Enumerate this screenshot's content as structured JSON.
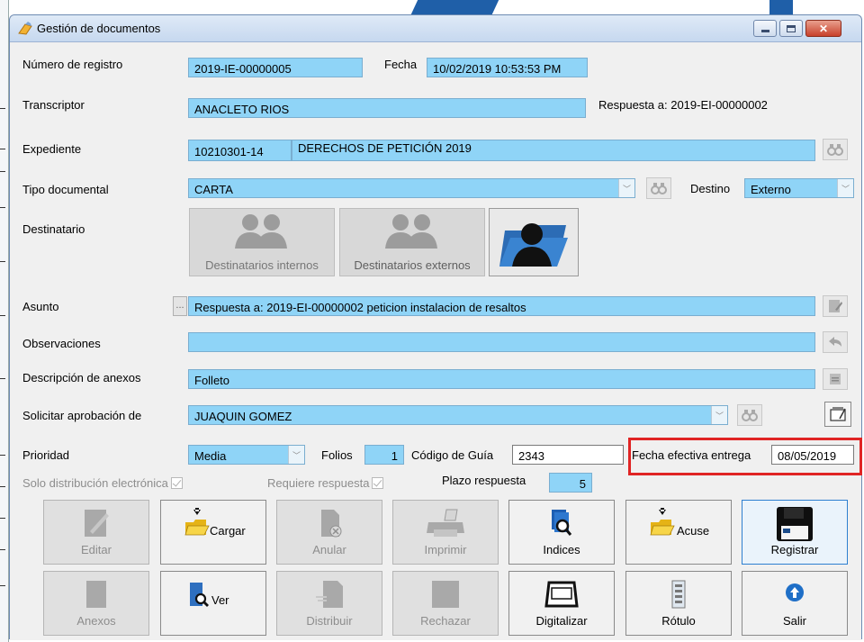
{
  "window": {
    "title": "Gestión de documentos"
  },
  "form": {
    "numero_registro": {
      "label": "Número de registro",
      "value": "2019-IE-00000005"
    },
    "fecha": {
      "label": "Fecha",
      "value": "10/02/2019 10:53:53 PM"
    },
    "transcriptor": {
      "label": "Transcriptor",
      "value": "ANACLETO RIOS"
    },
    "respuesta_a": "Respuesta a: 2019-EI-00000002",
    "expediente": {
      "label": "Expediente",
      "code": "10210301-14",
      "value": "DERECHOS DE PETICIÓN 2019"
    },
    "tipo_documental": {
      "label": "Tipo documental",
      "value": "CARTA"
    },
    "destino": {
      "label": "Destino",
      "value": "Externo"
    },
    "destinatario": {
      "label": "Destinatario",
      "internos": "Destinatarios internos",
      "externos": "Destinatarios externos"
    },
    "asunto": {
      "label": "Asunto",
      "ellipsis": "...",
      "value": "Respuesta a: 2019-EI-00000002 peticion instalacion de resaltos"
    },
    "observaciones": {
      "label": "Observaciones",
      "value": ""
    },
    "descripcion_anexos": {
      "label": "Descripción de anexos",
      "value": "Folleto"
    },
    "solicitar_aprobacion": {
      "label": "Solicitar aprobación de",
      "value": "JUAQUIN GOMEZ"
    },
    "prioridad": {
      "label": "Prioridad",
      "value": "Media"
    },
    "folios": {
      "label": "Folios",
      "value": "1"
    },
    "codigo_guia": {
      "label": "Código de Guía",
      "value": "2343"
    },
    "fecha_efectiva": {
      "label": "Fecha efectiva entrega",
      "value": "08/05/2019"
    },
    "solo_distribucion": {
      "label": "Solo distribución electrónica",
      "checked": true
    },
    "requiere_respuesta": {
      "label": "Requiere respuesta",
      "checked": true
    },
    "plazo_respuesta": {
      "label": "Plazo respuesta",
      "value": "5"
    }
  },
  "actions_row1": [
    {
      "label": "Editar",
      "icon": "edit-icon",
      "enabled": false
    },
    {
      "label": "Cargar",
      "icon": "load-folder-icon",
      "enabled": true
    },
    {
      "label": "Anular",
      "icon": "void-document-icon",
      "enabled": false
    },
    {
      "label": "Imprimir",
      "icon": "printer-icon",
      "enabled": false
    },
    {
      "label": "Indices",
      "icon": "index-search-icon",
      "enabled": true
    },
    {
      "label": "Acuse",
      "icon": "acknowledge-folder-icon",
      "enabled": true
    },
    {
      "label": "Registrar",
      "icon": "save-disk-icon",
      "enabled": true
    }
  ],
  "actions_row2": [
    {
      "label": "Anexos",
      "icon": "attachments-icon",
      "enabled": false
    },
    {
      "label": "Ver",
      "icon": "view-document-icon",
      "enabled": true
    },
    {
      "label": "Distribuir",
      "icon": "distribute-icon",
      "enabled": false
    },
    {
      "label": "Rechazar",
      "icon": "reject-icon",
      "enabled": false
    },
    {
      "label": "Digitalizar",
      "icon": "scanner-icon",
      "enabled": true
    },
    {
      "label": "Rótulo",
      "icon": "label-icon",
      "enabled": true
    },
    {
      "label": "Salir",
      "icon": "exit-info-icon",
      "enabled": true
    }
  ],
  "colors": {
    "field": "#8fd4f7",
    "highlight": "#e02424",
    "accent": "#2d7fd0"
  }
}
